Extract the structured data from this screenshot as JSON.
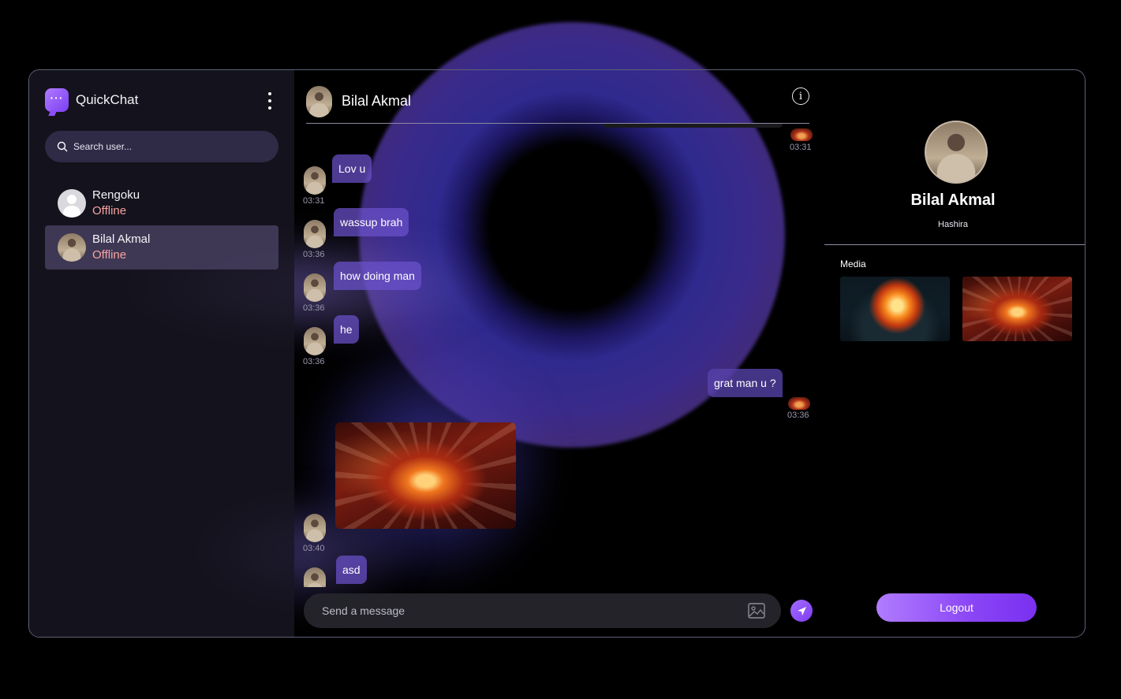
{
  "app": {
    "name": "QuickChat"
  },
  "sidebar": {
    "search_placeholder": "Search user...",
    "users": [
      {
        "name": "Rengoku",
        "status": "Offline"
      },
      {
        "name": "Bilal Akmal",
        "status": "Offline"
      }
    ]
  },
  "chat": {
    "contact_name": "Bilal Akmal",
    "messages": [
      {
        "side": "out",
        "type": "image",
        "time": "03:31"
      },
      {
        "side": "in",
        "type": "text",
        "text": "Lov u",
        "time": "03:31"
      },
      {
        "side": "in",
        "type": "text",
        "text": "wassup brah",
        "time": "03:36"
      },
      {
        "side": "in",
        "type": "text",
        "text": "how doing man",
        "time": "03:36"
      },
      {
        "side": "in",
        "type": "text",
        "text": "he",
        "time": "03:36"
      },
      {
        "side": "out",
        "type": "text",
        "text": "grat man u ?",
        "time": "03:36"
      },
      {
        "side": "in",
        "type": "image",
        "time": "03:40"
      },
      {
        "side": "in",
        "type": "text",
        "text": "asd",
        "time": ""
      }
    ],
    "composer_placeholder": "Send a message"
  },
  "profile": {
    "name": "Bilal Akmal",
    "bio": "Hashira",
    "media_label": "Media",
    "logout_label": "Logout"
  },
  "colors": {
    "accent": "#8a45f5",
    "offline": "#f7a3a3",
    "bubble": "#6b52cc"
  }
}
